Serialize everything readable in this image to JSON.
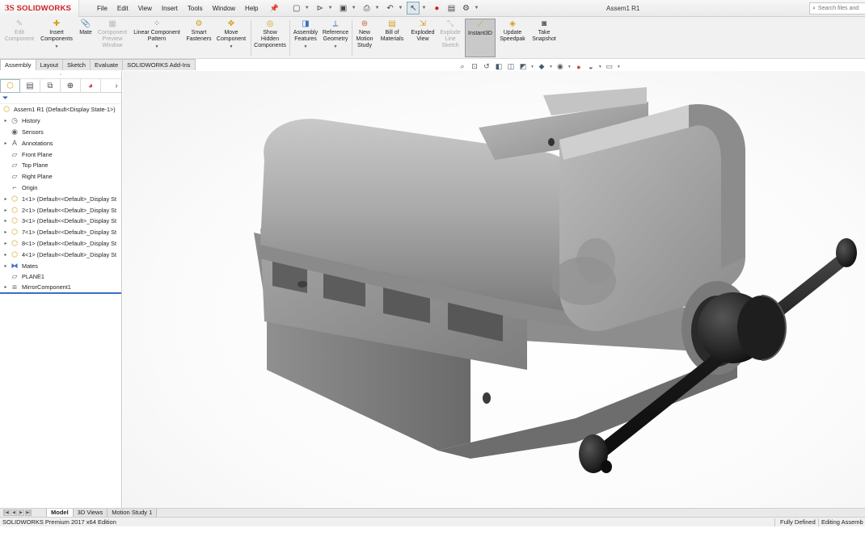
{
  "app": {
    "brand_ds": "3S",
    "brand_name": "SOLIDWORKS",
    "doc_title": "Assem1 R1"
  },
  "menu": [
    "File",
    "Edit",
    "View",
    "Insert",
    "Tools",
    "Window",
    "Help"
  ],
  "search": {
    "placeholder": "Search files and"
  },
  "commands": {
    "edit_component": [
      "Edit",
      "Component"
    ],
    "insert_components": [
      "Insert",
      "Components"
    ],
    "mate": [
      "Mate"
    ],
    "component_preview": [
      "Component",
      "Preview",
      "Window"
    ],
    "linear_pattern": [
      "Linear Component",
      "Pattern"
    ],
    "smart_fasteners": [
      "Smart",
      "Fasteners"
    ],
    "move_component": [
      "Move",
      "Component"
    ],
    "show_hidden": [
      "Show",
      "Hidden",
      "Components"
    ],
    "assembly_features": [
      "Assembly",
      "Features"
    ],
    "reference_geometry": [
      "Reference",
      "Geometry"
    ],
    "new_motion_study": [
      "New",
      "Motion",
      "Study"
    ],
    "bill_of_materials": [
      "Bill of",
      "Materials"
    ],
    "exploded_view": [
      "Exploded",
      "View"
    ],
    "explode_line_sketch": [
      "Explode",
      "Line",
      "Sketch"
    ],
    "instant3d": [
      "Instant3D"
    ],
    "update_speedpak": [
      "Update",
      "Speedpak"
    ],
    "take_snapshot": [
      "Take",
      "Snapshot"
    ]
  },
  "tabs": [
    "Assembly",
    "Layout",
    "Sketch",
    "Evaluate",
    "SOLIDWORKS Add-Ins"
  ],
  "tree": {
    "root": "Assem1 R1  (Default<Display State-1>)",
    "items": [
      {
        "label": "History",
        "icon": "history-icon",
        "arrow": true
      },
      {
        "label": "Sensors",
        "icon": "sensor-icon",
        "arrow": false
      },
      {
        "label": "Annotations",
        "icon": "annotations-icon",
        "arrow": true
      },
      {
        "label": "Front Plane",
        "icon": "plane-icon",
        "arrow": false
      },
      {
        "label": "Top Plane",
        "icon": "plane-icon",
        "arrow": false
      },
      {
        "label": "Right Plane",
        "icon": "plane-icon",
        "arrow": false
      },
      {
        "label": "Origin",
        "icon": "origin-icon",
        "arrow": false
      },
      {
        "label": "1<1> (Default<<Default>_Display St",
        "icon": "part-icon",
        "arrow": true
      },
      {
        "label": "2<1> (Default<<Default>_Display St",
        "icon": "part-icon",
        "arrow": true
      },
      {
        "label": "3<1> (Default<<Default>_Display St",
        "icon": "part-icon",
        "arrow": true
      },
      {
        "label": "7<1> (Default<<Default>_Display St",
        "icon": "part-icon",
        "arrow": true
      },
      {
        "label": "8<1> (Default<<Default>_Display St",
        "icon": "part-icon",
        "arrow": true
      },
      {
        "label": "4<1> (Default<<Default>_Display St",
        "icon": "part-icon",
        "arrow": true
      },
      {
        "label": "Mates",
        "icon": "mates-icon",
        "arrow": true
      },
      {
        "label": "PLANE1",
        "icon": "plane-icon",
        "arrow": false
      },
      {
        "label": "MirrorComponent1",
        "icon": "mirror-component-icon",
        "arrow": true
      }
    ]
  },
  "bottom_tabs": [
    "Model",
    "3D Views",
    "Motion Study 1"
  ],
  "status": {
    "edition": "SOLIDWORKS Premium 2017 x64 Edition",
    "state": "Fully Defined",
    "mode": "Editing Assemb"
  },
  "colors": {
    "brand": "#d02126",
    "selection": "#3a6fc4",
    "model_gray": "#9a9a9a",
    "handle_black": "#1e1e1e"
  }
}
